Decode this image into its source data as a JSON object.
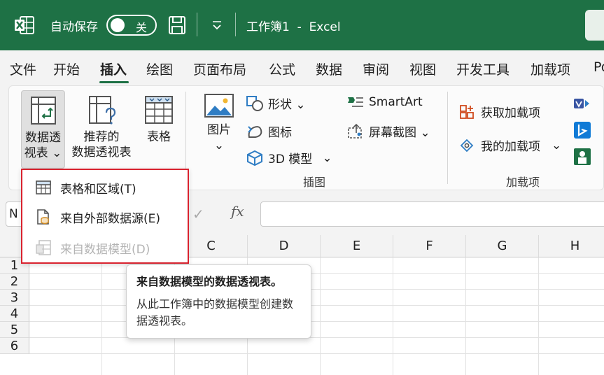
{
  "titlebar": {
    "autosave_label": "自动保存",
    "toggle_state": "关",
    "doc_title": "工作簿1  -  Excel",
    "bg_color": "#1e7145"
  },
  "tabs": [
    "文件",
    "开始",
    "插入",
    "绘图",
    "页面布局",
    "公式",
    "数据",
    "审阅",
    "视图",
    "开发工具",
    "加载项",
    "Po"
  ],
  "active_tab": "插入",
  "ribbon": {
    "pivot_table": {
      "line1": "数据透",
      "line2": "视表 ⌄"
    },
    "recommended_pivot": {
      "line1": "推荐的",
      "line2": "数据透视表"
    },
    "table": "表格",
    "picture": {
      "label": "图片",
      "chevron": "⌄"
    },
    "shapes": "形状 ⌄",
    "icons": "图标",
    "models_3d": "3D 模型",
    "smartart": "SmartArt",
    "screenshot": "屏幕截图 ⌄",
    "illustrations_group": "插图",
    "get_addins": "获取加载项",
    "my_addins": "我的加载项",
    "addins_group": "加载项",
    "chevron_down": "⌄"
  },
  "formula_bar": {
    "namebox_value": "N",
    "check": "✓",
    "fx": "fx"
  },
  "grid": {
    "columns": [
      "C",
      "D",
      "E",
      "F",
      "G",
      "H"
    ],
    "rows": [
      "1",
      "2",
      "3",
      "4",
      "5",
      "6"
    ]
  },
  "dropdown": {
    "items": [
      {
        "label": "表格和区域(T)",
        "disabled": false
      },
      {
        "label": "来自外部数据源(E)",
        "disabled": false
      },
      {
        "label": "来自数据模型(D)",
        "disabled": true
      }
    ]
  },
  "tooltip": {
    "title": "来自数据模型的数据透视表。",
    "body": "从此工作簿中的数据模型创建数据透视表。"
  }
}
